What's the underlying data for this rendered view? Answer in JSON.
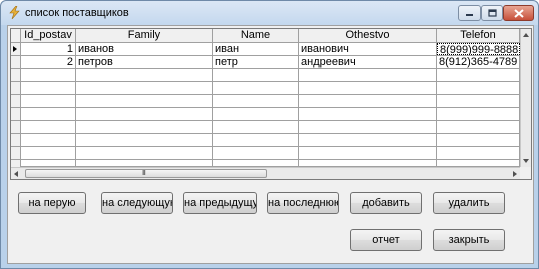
{
  "window": {
    "title": "список поставщиков",
    "icon": "app-lightning-icon"
  },
  "grid": {
    "columns": [
      "Id_postav",
      "Family",
      "Name",
      "Othestvo",
      "Telefon"
    ],
    "rows": [
      {
        "id": "1",
        "family": "иванов",
        "name": "иван",
        "othestvo": "иванович",
        "telefon": "8(999)999-8888",
        "current": true
      },
      {
        "id": "2",
        "family": "петров",
        "name": "петр",
        "othestvo": "андреевич",
        "telefon": "8(912)365-4789",
        "current": false
      }
    ],
    "scroll_grip": "III"
  },
  "buttons": {
    "first": "на перую",
    "next": "на следующую",
    "prev": "на предыдущую",
    "last": "на последнюю",
    "add": "добавить",
    "delete": "удалить",
    "report": "отчет",
    "close": "закрыть"
  }
}
